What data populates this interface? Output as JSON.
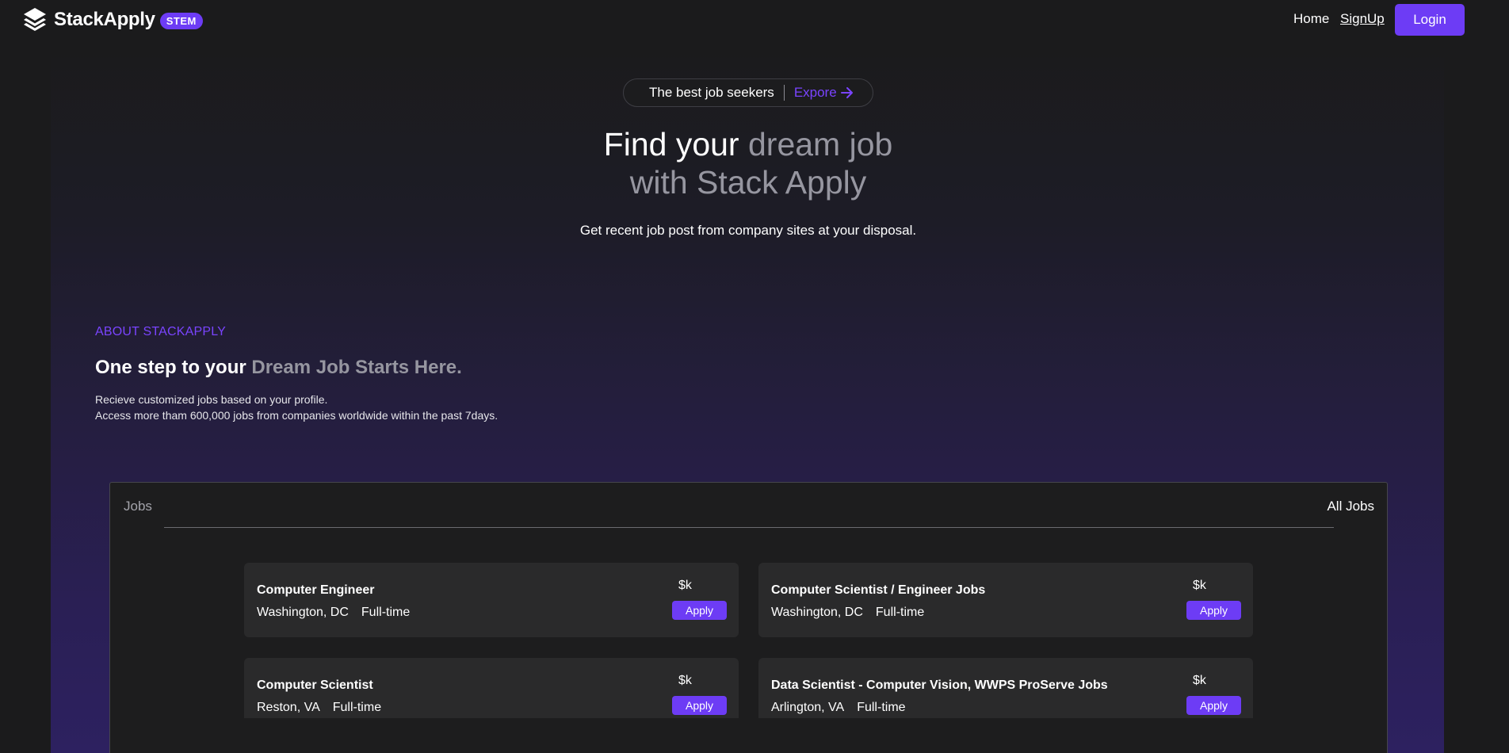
{
  "nav": {
    "brand_name": "StackApply",
    "brand_badge": "STEM",
    "home_label": "Home",
    "signup_label": "SignUp",
    "login_label": "Login"
  },
  "hero": {
    "pill_text": "The best job seekers",
    "pill_link": "Expore",
    "title_part1": "Find your ",
    "title_part2": "dream job",
    "title_part3": "with Stack Apply",
    "subtitle": "Get recent job post from company sites at your disposal."
  },
  "about": {
    "eyebrow": "ABOUT STACKAPPLY",
    "title_part1": "One step to your ",
    "title_part2": "Dream Job Starts Here.",
    "line1": "Recieve customized jobs based on your profile.",
    "line2": "Access more tham 600,000 jobs from companies worldwide within the past 7days."
  },
  "jobs": {
    "tab_label": "Jobs",
    "all_label": "All Jobs",
    "items": [
      {
        "title": "Computer Engineer",
        "location": "Washington, DC",
        "type": "Full-time",
        "salary": "$k",
        "apply": "Apply"
      },
      {
        "title": "Computer Scientist / Engineer Jobs",
        "location": "Washington, DC",
        "type": "Full-time",
        "salary": "$k",
        "apply": "Apply"
      },
      {
        "title": "Computer Scientist",
        "location": "Reston, VA",
        "type": "Full-time",
        "salary": "$k",
        "apply": "Apply"
      },
      {
        "title": "Data Scientist - Computer Vision, WWPS ProServe Jobs",
        "location": "Arlington, VA",
        "type": "Full-time",
        "salary": "$k",
        "apply": "Apply"
      }
    ]
  },
  "colors": {
    "accent": "#6d3cf5",
    "accent_text": "#7a44ff",
    "background": "#1b1b1c",
    "muted_text": "#9696a0",
    "card": "#2a2a2b"
  }
}
